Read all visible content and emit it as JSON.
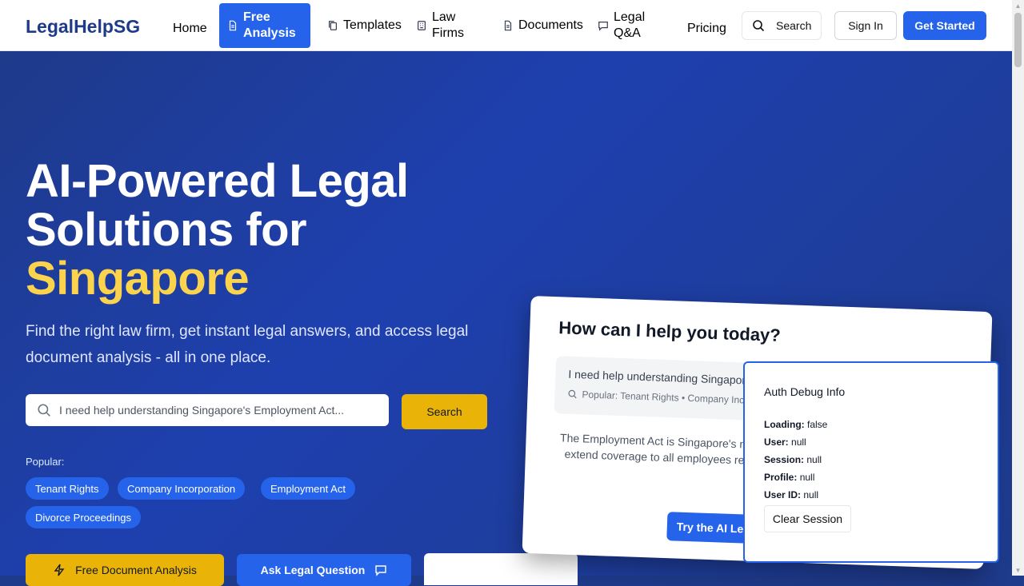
{
  "brand": "LegalHelpSG",
  "nav": {
    "home": "Home",
    "free_analysis_line1": "Free",
    "free_analysis_line2": "Analysis",
    "templates": "Templates",
    "law_firms_line1": "Law",
    "law_firms_line2": "Firms",
    "documents": "Documents",
    "legal_qa_line1": "Legal",
    "legal_qa_line2": "Q&A",
    "pricing": "Pricing",
    "search": "Search",
    "sign_in": "Sign In",
    "get_started": "Get Started"
  },
  "hero": {
    "headline_line1": "AI-Powered Legal",
    "headline_line2": "Solutions for",
    "headline_accent": "Singapore",
    "subtitle": "Find the right law firm, get instant legal answers, and access legal document analysis - all in one place.",
    "search_placeholder": "I need help understanding Singapore's Employment Act...",
    "search_button": "Search",
    "popular_label": "Popular:",
    "chips": [
      "Tenant Rights",
      "Company Incorporation",
      "Employment Act",
      "Divorce Proceedings"
    ],
    "cta_primary": "Free Document Analysis",
    "cta_secondary": "Ask Legal Question"
  },
  "card": {
    "title": "How can I help you today?",
    "input_text": "I need help understanding Singapor",
    "popular_text": "Popular: Tenant Rights • Company Inco",
    "body": "The Employment Act is Singapore's m working conditions for employees. T extend coverage to all employees reg public servants, domestic workers,",
    "button": "Try the AI Le"
  },
  "debug": {
    "title": "Auth Debug Info",
    "loading_label": "Loading:",
    "loading_value": "false",
    "user_label": "User:",
    "user_value": "null",
    "session_label": "Session:",
    "session_value": "null",
    "profile_label": "Profile:",
    "profile_value": "null",
    "userid_label": "User ID:",
    "userid_value": "null",
    "clear_button": "Clear Session"
  },
  "colors": {
    "primary": "#2563eb",
    "accent_yellow": "#fcd34d",
    "button_yellow": "#eab308",
    "hero_bg": "#1e3a8a"
  }
}
